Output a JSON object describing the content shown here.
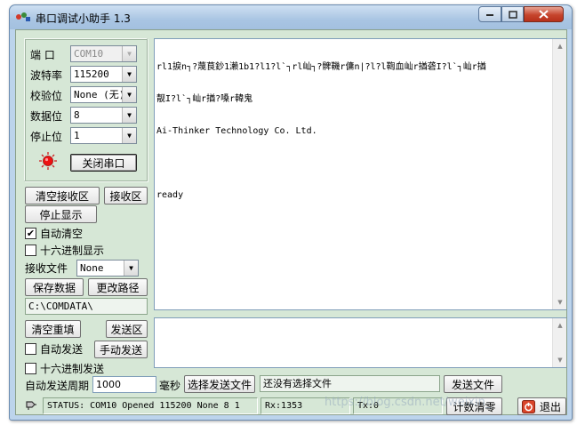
{
  "window": {
    "title": "串口调试小助手 1.3"
  },
  "port_settings": {
    "port_label": "端  口",
    "port_value": "COM10",
    "baud_label": "波特率",
    "baud_value": "115200",
    "parity_label": "校验位",
    "parity_value": "None (无)",
    "databits_label": "数据位",
    "databits_value": "8",
    "stopbits_label": "停止位",
    "stopbits_value": "1",
    "open_close_button": "关闭串口",
    "status_led_color": "#ee1111"
  },
  "receive_panel": {
    "clear_receive_button": "清空接收区",
    "receive_area_button": "接收区",
    "stop_display_button": "停止显示",
    "auto_clear_label": "自动清空",
    "auto_clear_checked": true,
    "hex_display_label": "十六进制显示",
    "hex_display_checked": false,
    "receive_file_label": "接收文件",
    "receive_file_value": "None",
    "save_data_button": "保存数据",
    "change_path_button": "更改路径",
    "path_value": "C:\\COMDATA\\"
  },
  "receive_text": {
    "line1": "rl1捩n┐?蔑茛鈔1瀨1b1?l1?l`┐rl屾┐?髀鞿r傭n|?l?l鞫血屾r揂砻I?l`┐屾r揂",
    "line2": "靓I?l`┐屾r揂?嗓r韓鬼",
    "line3": "Ai-Thinker Technology Co. Ltd.",
    "line4": "",
    "line5": "ready"
  },
  "send_panel": {
    "clear_resend_button": "清空重填",
    "send_area_button": "发送区",
    "auto_send_label": "自动发送",
    "auto_send_checked": false,
    "manual_send_button": "手动发送",
    "hex_send_label": "十六进制发送",
    "hex_send_checked": false,
    "period_label": "自动发送周期",
    "period_value": "1000",
    "ms_label": "毫秒",
    "select_file_button": "选择发送文件",
    "file_status": "还没有选择文件",
    "send_file_button": "发送文件"
  },
  "status_bar": {
    "status_text": "STATUS: COM10 Opened 115200 None  8  1",
    "rx_text": "Rx:1353",
    "tx_text": "Tx:0",
    "clear_count_button": "计数清零",
    "exit_button": "退出"
  },
  "watermark": "https://blog.csdn.net/weixin_"
}
